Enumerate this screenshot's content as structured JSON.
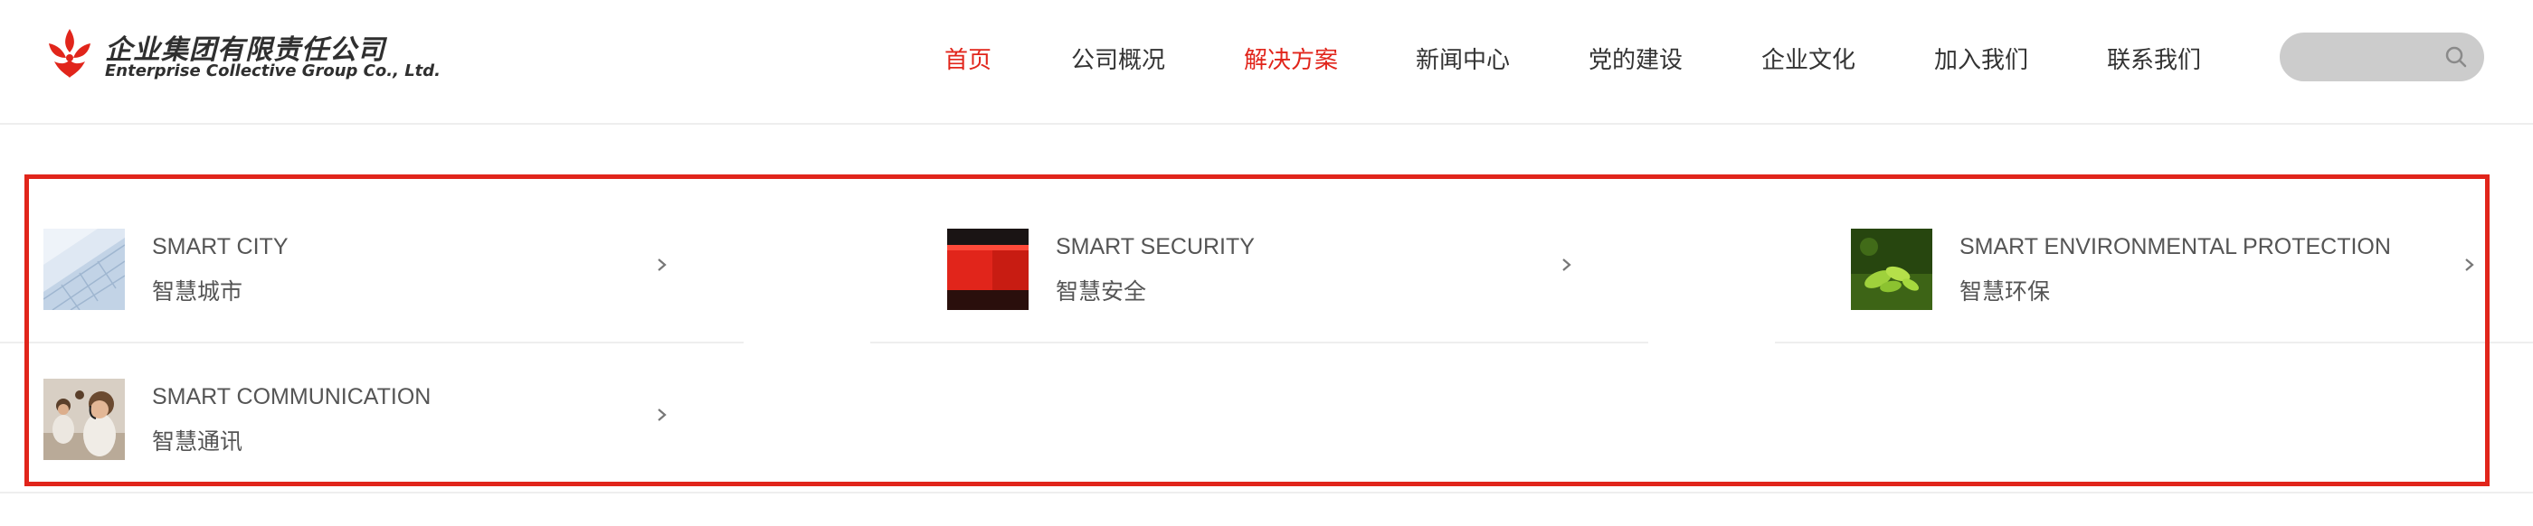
{
  "header": {
    "logo": {
      "name_cn": "企业集团有限责任公司",
      "name_en": "Enterprise Collective Group Co., Ltd."
    },
    "nav": [
      {
        "label": "首页",
        "active": true
      },
      {
        "label": "公司概况",
        "active": false
      },
      {
        "label": "解决方案",
        "active": true
      },
      {
        "label": "新闻中心",
        "active": false
      },
      {
        "label": "党的建设",
        "active": false
      },
      {
        "label": "企业文化",
        "active": false
      },
      {
        "label": "加入我们",
        "active": false
      },
      {
        "label": "联系我们",
        "active": false
      }
    ],
    "search": {
      "value": "",
      "placeholder": ""
    }
  },
  "solutions": [
    {
      "title_en": "SMART CITY",
      "title_cn": "智慧城市",
      "thumb_icon": "glass-building-image"
    },
    {
      "title_en": "SMART SECURITY",
      "title_cn": "智慧安全",
      "thumb_icon": "red-box-image"
    },
    {
      "title_en": "SMART ENVIRONMENTAL PROTECTION",
      "title_cn": "智慧环保",
      "thumb_icon": "green-leaves-image"
    },
    {
      "title_en": "SMART COMMUNICATION",
      "title_cn": "智慧通讯",
      "thumb_icon": "call-center-image"
    }
  ],
  "colors": {
    "accent": "#e1251b",
    "text": "#333333",
    "muted_text": "#555555",
    "search_bg": "#cccccc",
    "divider": "#eeeeee"
  }
}
